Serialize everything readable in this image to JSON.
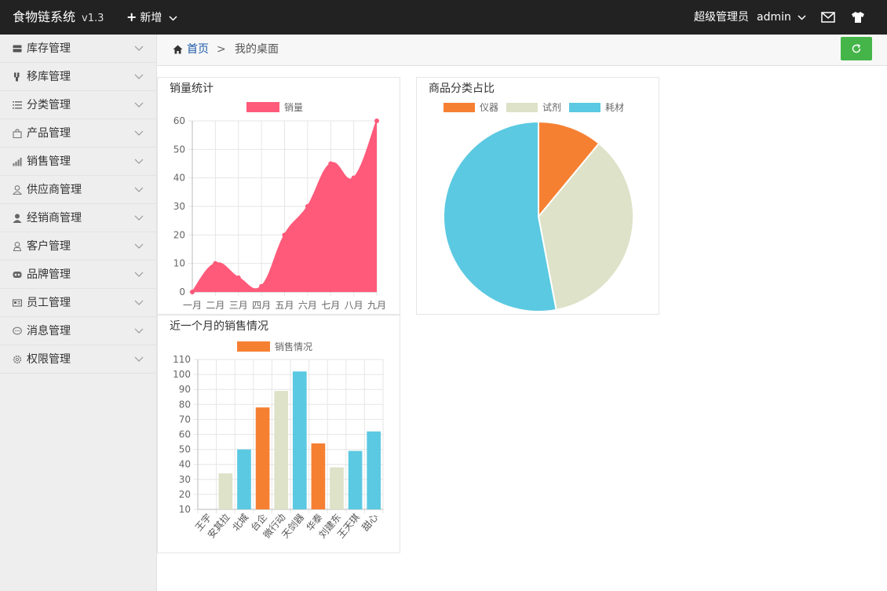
{
  "header": {
    "brand": "食物链系统",
    "version": "v1.3",
    "add_label": "新增",
    "role": "超级管理员",
    "username": "admin"
  },
  "sidebar": {
    "items": [
      {
        "label": "库存管理",
        "icon": "inventory-icon"
      },
      {
        "label": "移库管理",
        "icon": "transfer-icon"
      },
      {
        "label": "分类管理",
        "icon": "list-icon"
      },
      {
        "label": "产品管理",
        "icon": "bag-icon"
      },
      {
        "label": "销售管理",
        "icon": "bar-chart-icon"
      },
      {
        "label": "供应商管理",
        "icon": "user-icon"
      },
      {
        "label": "经销商管理",
        "icon": "person-icon"
      },
      {
        "label": "客户管理",
        "icon": "customer-icon"
      },
      {
        "label": "品牌管理",
        "icon": "brand-icon"
      },
      {
        "label": "员工管理",
        "icon": "id-card-icon"
      },
      {
        "label": "消息管理",
        "icon": "message-icon"
      },
      {
        "label": "权限管理",
        "icon": "gear-icon"
      }
    ]
  },
  "breadcrumb": {
    "home": "首页",
    "separator": ">",
    "current": "我的桌面"
  },
  "colors": {
    "sales_line": "#ff5a7a",
    "orange": "#f68032",
    "beige": "#dde2c8",
    "cyan": "#5bc9e1",
    "refresh": "#45b549"
  },
  "panels": {
    "sales_title": "销量统计",
    "pie_title": "商品分类占比",
    "month_title": "近一个月的销售情况"
  },
  "chart_data": [
    {
      "type": "area",
      "categories": [
        "一月",
        "二月",
        "三月",
        "四月",
        "五月",
        "六月",
        "七月",
        "八月",
        "九月"
      ],
      "series": [
        {
          "name": "销量",
          "values": [
            0,
            10,
            5,
            2,
            20,
            30,
            45,
            40,
            60
          ]
        }
      ],
      "ylim": [
        0,
        60
      ],
      "yticks": [
        0,
        10,
        20,
        30,
        40,
        50,
        60
      ],
      "legend": "top",
      "grid": true
    },
    {
      "type": "pie",
      "labels": [
        "仪器",
        "试剂",
        "耗材"
      ],
      "values": [
        11,
        36,
        53
      ],
      "legend": "top"
    },
    {
      "type": "bar",
      "categories": [
        "王宇",
        "安其拉",
        "北城",
        "台企",
        "微行动",
        "天剑器",
        "华泰",
        "刘建东",
        "王天琪",
        "甜心"
      ],
      "series": [
        {
          "name": "销售情况",
          "values": [
            10,
            34,
            50,
            78,
            89,
            102,
            54,
            38,
            49,
            62
          ]
        }
      ],
      "bar_colors": [
        "#f68032",
        "#dde2c8",
        "#5bc9e1",
        "#f68032",
        "#dde2c8",
        "#5bc9e1",
        "#f68032",
        "#dde2c8",
        "#5bc9e1",
        "#5bc9e1"
      ],
      "ylim": [
        10,
        110
      ],
      "yticks": [
        10,
        20,
        30,
        40,
        50,
        60,
        70,
        80,
        90,
        100,
        110
      ],
      "legend": "top",
      "grid": true
    }
  ]
}
